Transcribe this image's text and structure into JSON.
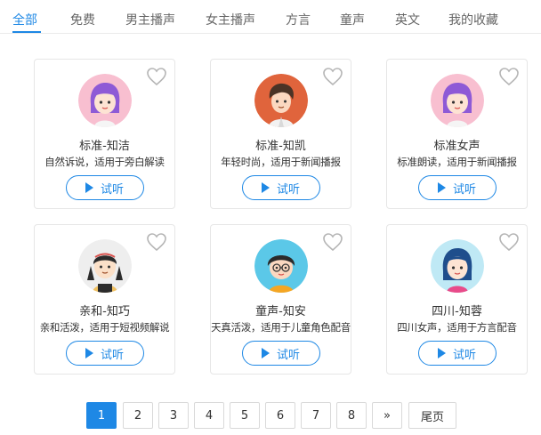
{
  "tabs": [
    {
      "label": "全部",
      "active": true
    },
    {
      "label": "免费"
    },
    {
      "label": "男主播声"
    },
    {
      "label": "女主播声"
    },
    {
      "label": "方言"
    },
    {
      "label": "童声"
    },
    {
      "label": "英文"
    },
    {
      "label": "我的收藏"
    }
  ],
  "voices": [
    {
      "name": "标准-知洁",
      "desc": "自然诉说，适用于旁白解读",
      "listen": "试听",
      "avatar_icon": "girl-purple-hair-avatar"
    },
    {
      "name": "标准-知凯",
      "desc": "年轻时尚，适用于新闻播报",
      "listen": "试听",
      "avatar_icon": "boy-orange-bg-avatar"
    },
    {
      "name": "标准女声",
      "desc": "标准朗读，适用于新闻播报",
      "listen": "试听",
      "avatar_icon": "girl-purple-hair-avatar"
    },
    {
      "name": "亲和-知巧",
      "desc": "亲和活泼，适用于短视频解说",
      "listen": "试听",
      "avatar_icon": "girl-pigtails-avatar"
    },
    {
      "name": "童声-知安",
      "desc": "天真活泼，适用于儿童角色配音",
      "listen": "试听",
      "avatar_icon": "child-glasses-avatar"
    },
    {
      "name": "四川-知蓉",
      "desc": "四川女声，适用于方言配音",
      "listen": "试听",
      "avatar_icon": "girl-teal-hair-avatar"
    }
  ],
  "pagination": {
    "pages": [
      "1",
      "2",
      "3",
      "4",
      "5",
      "6",
      "7",
      "8"
    ],
    "current": "1",
    "next": "»",
    "last": "尾页"
  },
  "colors": {
    "accent": "#1e88e5",
    "border": "#e6e6e6",
    "text": "#333333"
  }
}
